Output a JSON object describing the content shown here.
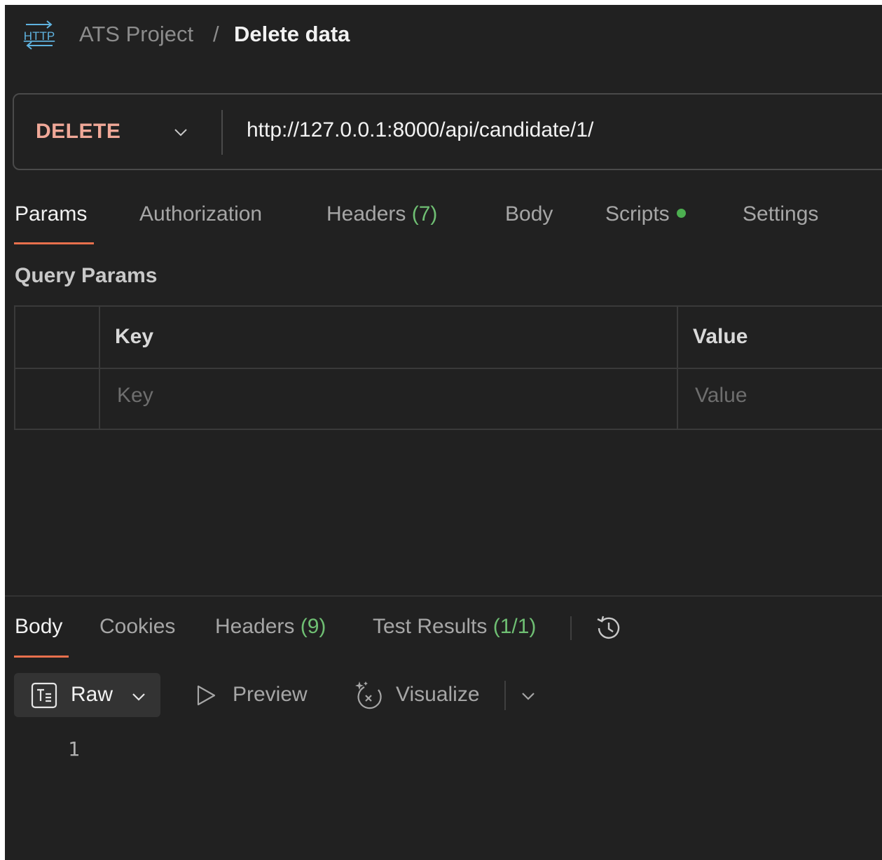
{
  "header": {
    "icon_label": "HTTP",
    "collection": "ATS Project",
    "separator": "/",
    "request_name": "Delete data"
  },
  "request": {
    "method": "DELETE",
    "url": "http://127.0.0.1:8000/api/candidate/1/"
  },
  "request_tabs": {
    "params": "Params",
    "authorization": "Authorization",
    "headers": "Headers",
    "headers_count": "(7)",
    "body": "Body",
    "scripts": "Scripts",
    "settings": "Settings"
  },
  "query_params": {
    "title": "Query Params",
    "columns": {
      "key": "Key",
      "value": "Value"
    },
    "placeholders": {
      "key": "Key",
      "value": "Value"
    }
  },
  "response_tabs": {
    "body": "Body",
    "cookies": "Cookies",
    "headers": "Headers",
    "headers_count": "(9)",
    "test_results": "Test Results",
    "test_results_count": "(1/1)"
  },
  "response_toolbar": {
    "raw": "Raw",
    "preview": "Preview",
    "visualize": "Visualize"
  },
  "response_body": {
    "line_numbers": [
      "1"
    ]
  },
  "colors": {
    "background": "#212121",
    "method_delete": "#f0a898",
    "accent_underline": "#e8704d",
    "count_green": "#6fbf73",
    "scripts_dot": "#4caf50",
    "http_icon": "#5fb3e0"
  },
  "icons": {
    "http": "http-icon",
    "method_dropdown": "chevron-down-icon",
    "history": "history-icon",
    "raw": "text-format-icon",
    "preview": "play-icon",
    "visualize": "visualize-sparkle-icon",
    "more": "chevron-down-icon"
  }
}
